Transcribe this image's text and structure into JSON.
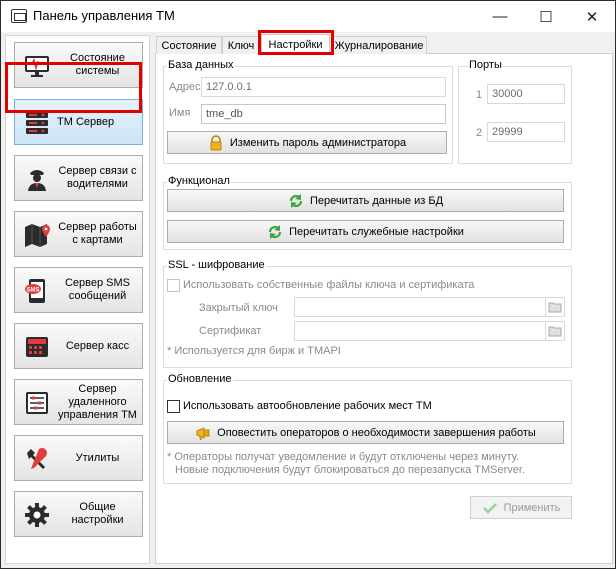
{
  "window": {
    "title": "Панель управления ТМ"
  },
  "titlebar": {
    "minimize": "—",
    "maximize": "☐",
    "close": "✕"
  },
  "sidebar": {
    "items": [
      {
        "label": "Состояние системы",
        "icon": "monitor-icon"
      },
      {
        "label": "ТМ Сервер",
        "icon": "server-icon",
        "selected": true
      },
      {
        "label": "Сервер связи с водителями",
        "icon": "driver-icon"
      },
      {
        "label": "Сервер работы с картами",
        "icon": "map-icon"
      },
      {
        "label": "Сервер SMS сообщений",
        "icon": "sms-icon"
      },
      {
        "label": "Сервер касс",
        "icon": "cash-register-icon"
      },
      {
        "label": "Сервер удаленного управления ТМ",
        "icon": "remote-control-icon"
      },
      {
        "label": "Утилиты",
        "icon": "tools-icon"
      },
      {
        "label": "Общие настройки",
        "icon": "gear-icon"
      }
    ]
  },
  "tabs": [
    {
      "label": "Состояние"
    },
    {
      "label": "Ключ"
    },
    {
      "label": "Настройки",
      "active": true
    },
    {
      "label": "Журналирование"
    }
  ],
  "database": {
    "legend": "База данных",
    "address_label": "Адрес",
    "address_value": "127.0.0.1",
    "name_label": "Имя",
    "name_value": "tme_db",
    "change_password_button": "Изменить пароль администратора"
  },
  "ports": {
    "legend": "Порты",
    "port1_label": "1",
    "port1_value": "30000",
    "port2_label": "2",
    "port2_value": "29999"
  },
  "functional": {
    "legend": "Функционал",
    "reload_db_button": "Перечитать данные из БД",
    "reload_settings_button": "Перечитать служебные настройки"
  },
  "ssl": {
    "legend": "SSL - шифрование",
    "use_own_files_label": "Использовать собственные файлы ключа и сертификата",
    "private_key_label": "Закрытый ключ",
    "private_key_value": "",
    "certificate_label": "Сертификат",
    "certificate_value": "",
    "note": "* Используется для бирж и TMAPI"
  },
  "update": {
    "legend": "Обновление",
    "auto_update_label": "Использовать автообновление рабочих мест ТМ",
    "notify_button": "Оповестить операторов о необходимости завершения работы",
    "note_line1": "* Операторы получат уведомление и будут отключены через минуту.",
    "note_line2": "Новые подключения будут блокироваться до перезапуска TMServer."
  },
  "apply_button": "Применить",
  "colors": {
    "selection_frame": "#e00000",
    "active_nav": "#cce4f7",
    "green_icon": "#3aa53a",
    "sms_red": "#e23b3b"
  }
}
